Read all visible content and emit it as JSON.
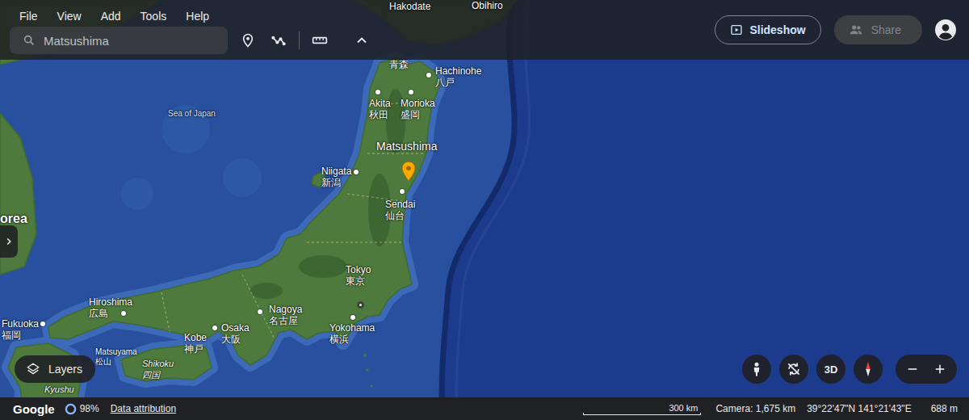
{
  "menu": [
    "File",
    "View",
    "Add",
    "Tools",
    "Help"
  ],
  "search": {
    "value": "Matsushima"
  },
  "actions": {
    "slideshow": "Slideshow",
    "share": {
      "label": "Share",
      "disabled": true
    }
  },
  "map": {
    "places": [
      {
        "name": "Hakodate",
        "kind": "city"
      },
      {
        "name": "Obihiro",
        "kind": "city"
      },
      {
        "native": "青森",
        "kind": "city"
      },
      {
        "name": "Hachinohe",
        "native": "八戸",
        "kind": "city"
      },
      {
        "name": "Akita",
        "native": "秋田",
        "kind": "city"
      },
      {
        "name": "Morioka",
        "native": "盛岡",
        "kind": "city"
      },
      {
        "name": "Sea of Japan",
        "kind": "sea"
      },
      {
        "name": "Matsushima",
        "kind": "result"
      },
      {
        "name": "Niigata",
        "native": "新潟",
        "kind": "city"
      },
      {
        "name": "Sendai",
        "native": "仙台",
        "kind": "city"
      },
      {
        "name": "orea",
        "kind": "country"
      },
      {
        "name": "Tokyo",
        "native": "東京",
        "kind": "capital"
      },
      {
        "name": "Hiroshima",
        "native": "広島",
        "kind": "city"
      },
      {
        "name": "Nagoya",
        "native": "名古屋",
        "kind": "city"
      },
      {
        "name": "Osaka",
        "native": "大阪",
        "kind": "city"
      },
      {
        "name": "Yokohama",
        "native": "横浜",
        "kind": "city"
      },
      {
        "name": "Fukuoka",
        "native": "福岡",
        "kind": "city"
      },
      {
        "name": "Kobe",
        "native": "神戸",
        "kind": "city"
      },
      {
        "name": "Matsuyama",
        "native": "松山",
        "kind": "town"
      },
      {
        "name": "Shikoku",
        "native": "四国",
        "kind": "region"
      },
      {
        "name": "Kyushu",
        "kind": "region"
      }
    ]
  },
  "layers": {
    "label": "Layers"
  },
  "view_controls": {
    "mode": "3D"
  },
  "status_bar": {
    "brand": "Google",
    "loading": {
      "text": "98%",
      "level": 0.98
    },
    "attribution": "Data attribution",
    "scale": "300 km",
    "camera": "Camera: 1,675 km",
    "coordinates": "39°22'47\"N 141°21'43\"E",
    "elevation": "688 m"
  }
}
